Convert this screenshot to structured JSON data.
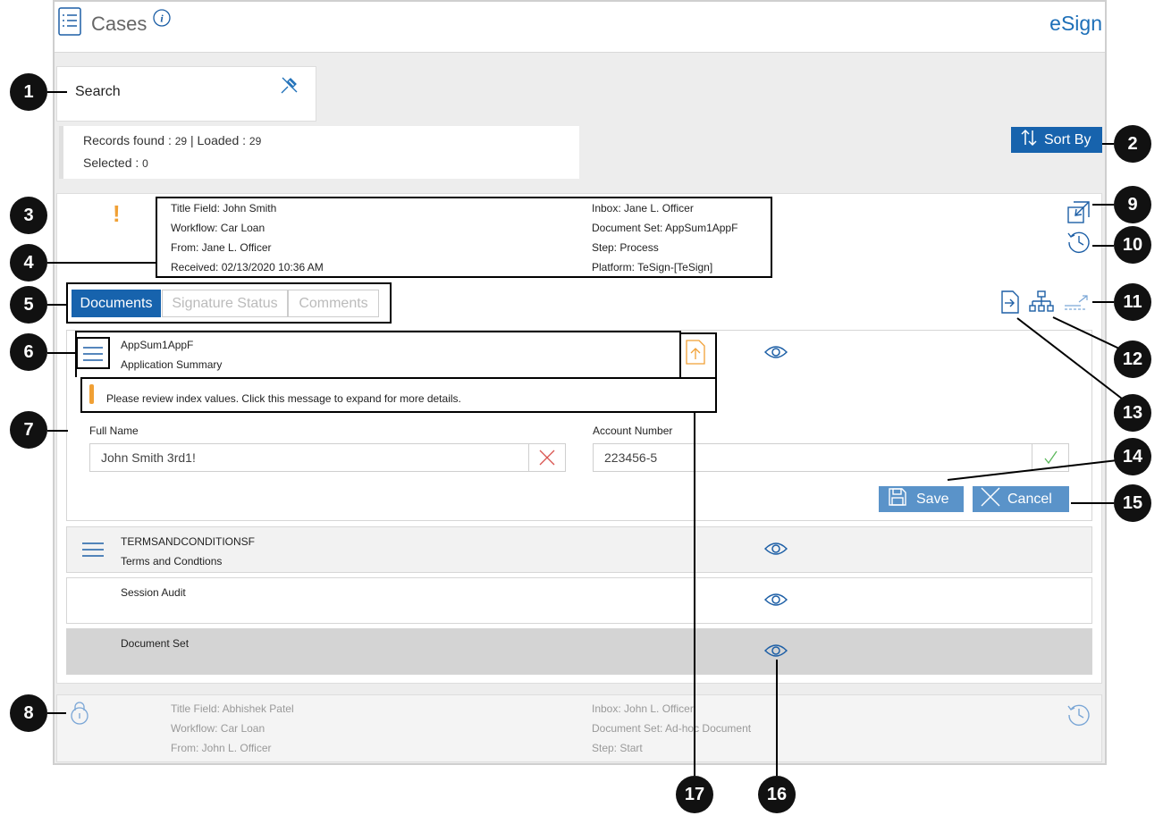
{
  "header": {
    "title": "Cases",
    "brand": "eSign"
  },
  "search": {
    "label": "Search"
  },
  "stats": {
    "records_label": "Records found : ",
    "records_value": "29",
    "loaded_sep": " | Loaded : ",
    "loaded_value": "29",
    "selected_label": "Selected : ",
    "selected_value": "0"
  },
  "sort": {
    "label": "Sort By"
  },
  "case1": {
    "title_field": "Title Field: John Smith",
    "workflow": "Workflow: Car Loan",
    "from": "From: Jane L. Officer",
    "received": "Received: 02/13/2020 10:36 AM",
    "inbox": "Inbox: Jane L. Officer",
    "document_set": "Document Set: AppSum1AppF",
    "step": "Step: Process",
    "platform": "Platform: TeSign-[TeSign]",
    "alert_icon": "!"
  },
  "tabs": [
    "Documents",
    "Signature Status",
    "Comments"
  ],
  "doc1": {
    "code": "AppSum1AppF",
    "name": "Application Summary",
    "message": "Please review index values. Click this message to expand for more details.",
    "full_name_label": "Full Name",
    "full_name_value": "John Smith 3rd1!",
    "account_label": "Account Number",
    "account_value": "223456-5",
    "save": "Save",
    "cancel": "Cancel"
  },
  "doc2": {
    "code": "TERMSANDCONDITIONSF",
    "name": "Terms and Condtions"
  },
  "doc3": {
    "name": "Session Audit"
  },
  "doc4": {
    "name": "Document Set"
  },
  "case2": {
    "title_field": "Title Field: Abhishek Patel",
    "workflow": "Workflow: Car Loan",
    "from": "From: John L. Officer",
    "inbox": "Inbox: John L. Officer",
    "document_set": "Document Set: Ad-hoc Document",
    "step": "Step: Start"
  },
  "callouts": [
    "1",
    "2",
    "3",
    "4",
    "5",
    "6",
    "7",
    "8",
    "9",
    "10",
    "11",
    "12",
    "13",
    "14",
    "15",
    "16",
    "17"
  ],
  "colors": {
    "accent": "#1d5fa6",
    "button": "#5a93c9",
    "warning": "#f0a035",
    "error": "#d9534f",
    "ok": "#5cb85c"
  }
}
